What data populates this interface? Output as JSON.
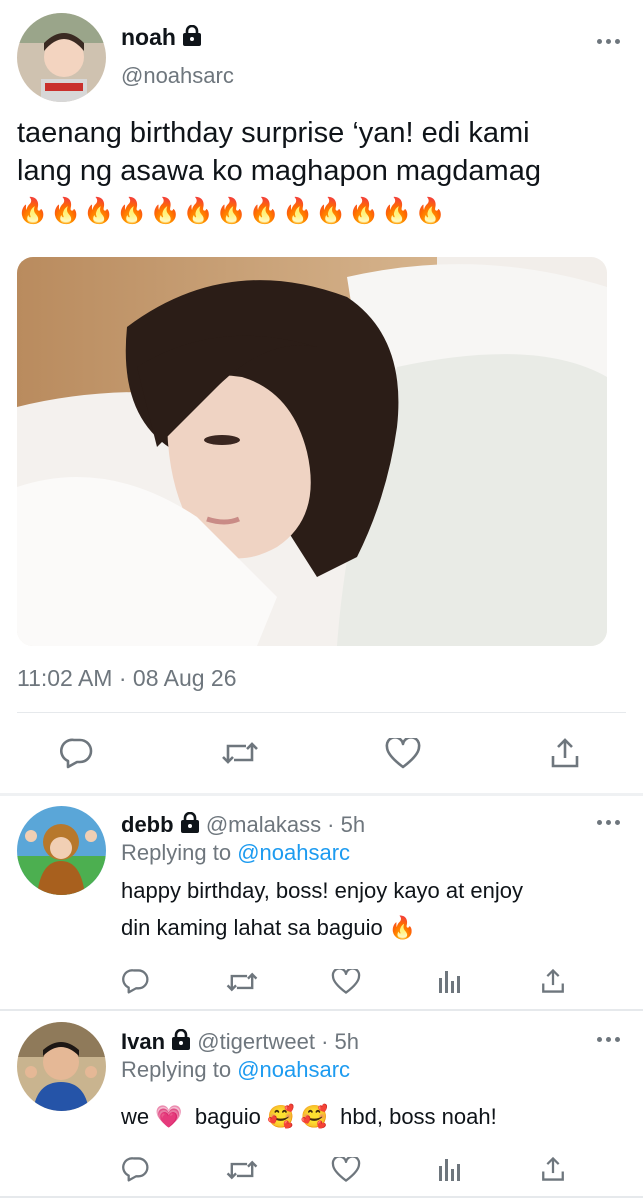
{
  "main_tweet": {
    "display_name": "noah",
    "handle": "@noahsarc",
    "text_line1": "taenang birthday surprise ‘yan! edi kami",
    "text_line2": "lang ng asawa ko maghapon magdamag",
    "emoji_line": "🔥🔥🔥🔥🔥🔥🔥🔥🔥🔥🔥🔥🔥",
    "timestamp": "11:02 AM · 08 Aug 26",
    "actions": [
      "reply-icon",
      "retweet-icon",
      "like-icon",
      "share-icon"
    ]
  },
  "replies": [
    {
      "display_name": "debb",
      "handle_time": "@malakass · 5h",
      "replying_prefix": "Replying to",
      "replying_to": "@noahsarc",
      "text_line1": "happy birthday, boss! enjoy kayo at enjoy",
      "text_line2": "din kaming lahat sa baguio 🔥"
    },
    {
      "display_name": "Ivan",
      "handle_time": "@tigertweet · 5h",
      "replying_prefix": "Replying to",
      "replying_to": "@noahsarc",
      "text_line1": "we 💗  baguio 🥰 🥰  hbd, boss noah!"
    }
  ],
  "colors": {
    "link": "#1d9bf0",
    "secondary": "#6e767d",
    "divider": "#e6e9ec"
  }
}
